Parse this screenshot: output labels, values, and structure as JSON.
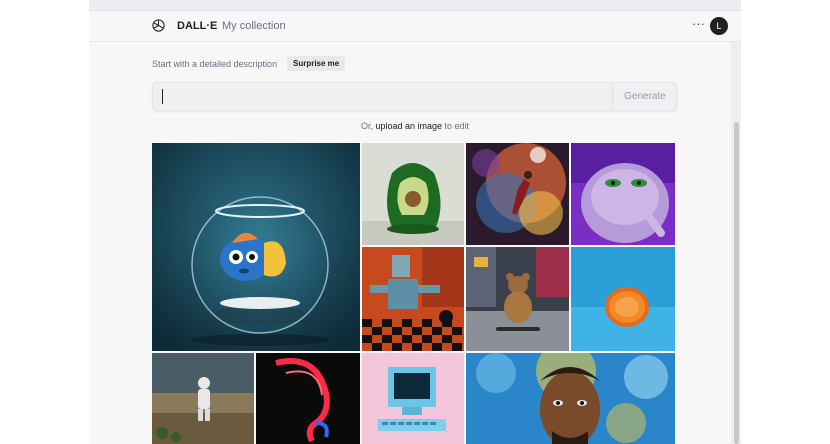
{
  "header": {
    "brand": "DALL·E",
    "collection_link": "My collection",
    "menu": "···",
    "avatar_initial": "L"
  },
  "prompt": {
    "label": "Start with a detailed description",
    "surprise_button": "Surprise me",
    "input_value": "",
    "generate_button": "Generate"
  },
  "upload": {
    "prefix": "Or, ",
    "link": "upload an image",
    "suffix": " to edit"
  },
  "gallery": [
    "goldfish-bowl-icon",
    "avocado-chair-icon",
    "space-basketball-icon",
    "purple-monster-icon",
    "robot-chess-icon",
    "teddy-skateboard-icon",
    "orange-half-icon",
    "astronaut-desert-icon",
    "neon-face-icon",
    "retro-computer-icon",
    "painted-portrait-icon"
  ],
  "colors": {
    "accent": "#202123",
    "background": "#f7f7f8"
  }
}
